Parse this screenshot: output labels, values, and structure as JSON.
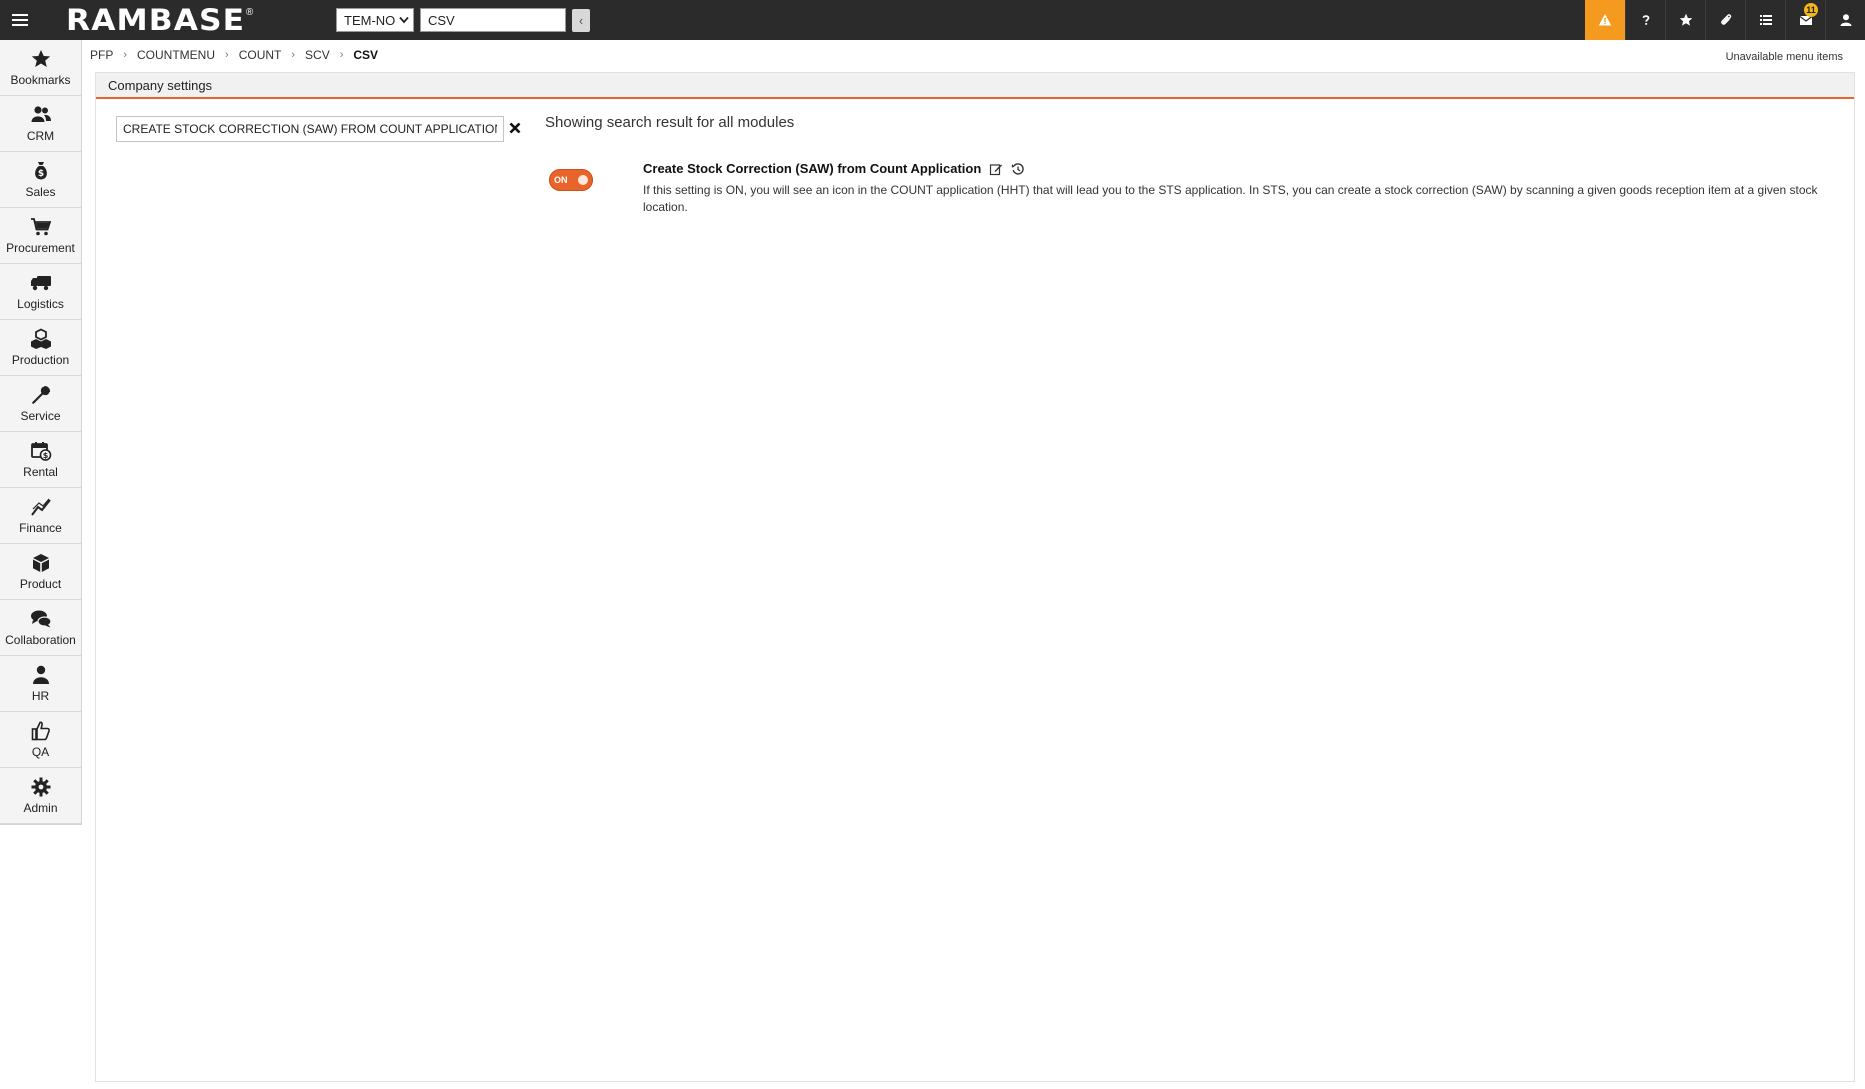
{
  "app": {
    "logo": "RAMBASE",
    "logo_mark": "®"
  },
  "topbar": {
    "company": "TEM-NO",
    "search_value": "CSV",
    "back_label": "‹",
    "icons": [
      "warning-icon",
      "help-icon",
      "star-icon",
      "paperclip-icon",
      "list-icon",
      "mail-icon",
      "user-icon"
    ],
    "mail_badge": "11",
    "warning_color": "#f39a1f"
  },
  "sidebar": {
    "items": [
      {
        "label": "Bookmarks",
        "icon": "star-icon"
      },
      {
        "label": "CRM",
        "icon": "people-icon"
      },
      {
        "label": "Sales",
        "icon": "money-bag-icon"
      },
      {
        "label": "Procurement",
        "icon": "cart-icon"
      },
      {
        "label": "Logistics",
        "icon": "truck-icon"
      },
      {
        "label": "Production",
        "icon": "boxes-icon"
      },
      {
        "label": "Service",
        "icon": "wrench-icon"
      },
      {
        "label": "Rental",
        "icon": "rental-icon"
      },
      {
        "label": "Finance",
        "icon": "chart-line-icon"
      },
      {
        "label": "Product",
        "icon": "cube-icon"
      },
      {
        "label": "Collaboration",
        "icon": "chat-icon"
      },
      {
        "label": "HR",
        "icon": "person-icon"
      },
      {
        "label": "QA",
        "icon": "thumbs-up-icon"
      },
      {
        "label": "Admin",
        "icon": "gear-icon"
      }
    ]
  },
  "breadcrumb": [
    "PFP",
    "COUNTMENU",
    "COUNT",
    "SCV",
    "CSV"
  ],
  "header": {
    "unavailable_link": "Unavailable menu items"
  },
  "panel": {
    "title": "Company settings",
    "accent_color": "#e9642a",
    "search_value": "CREATE STOCK CORRECTION (SAW) FROM COUNT APPLICATION",
    "result_heading": "Showing search result for all modules",
    "setting": {
      "toggle_label": "ON",
      "title": "Create Stock Correction (SAW) from Count Application",
      "description": "If this setting is ON, you will see an icon in the COUNT application (HHT) that will lead you to the STS application. In STS, you can create a stock correction (SAW) by scanning a given goods reception item at a given stock location."
    }
  }
}
